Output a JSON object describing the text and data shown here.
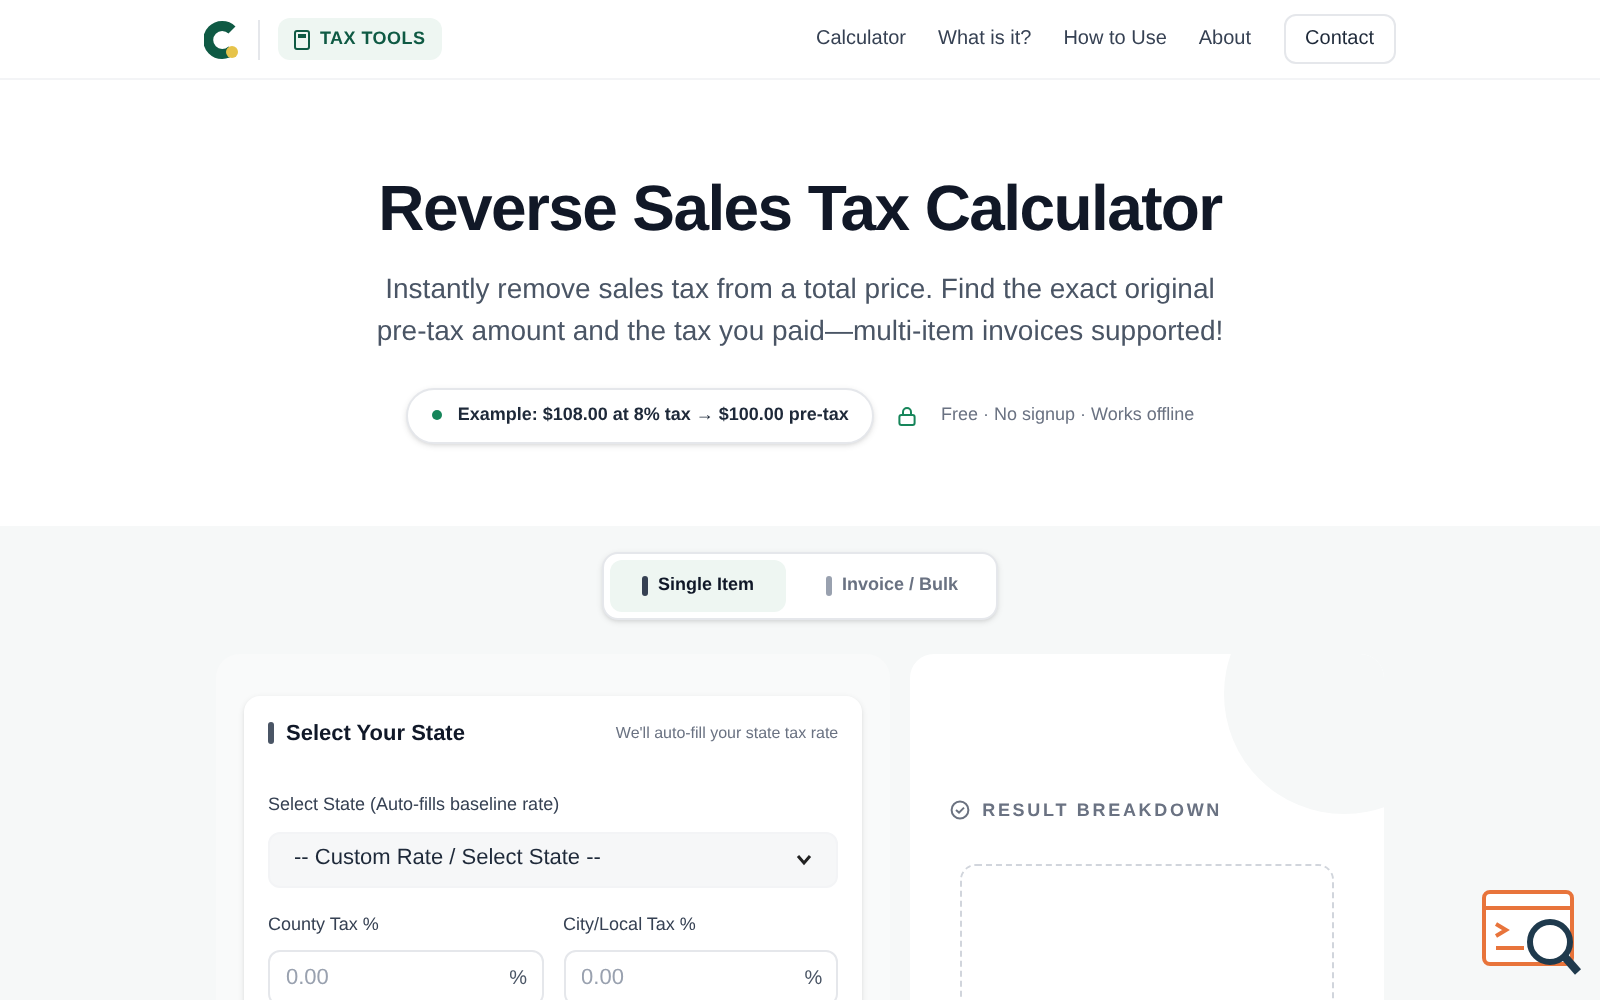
{
  "header": {
    "brand_badge": "TAX TOOLS",
    "nav": [
      {
        "label": "Calculator"
      },
      {
        "label": "What is it?"
      },
      {
        "label": "How to Use"
      },
      {
        "label": "About"
      }
    ],
    "contact_button": "Contact"
  },
  "hero": {
    "title": "Reverse Sales Tax Calculator",
    "subtitle": "Instantly remove sales tax from a total price. Find the exact original pre-tax amount and the tax you paid—multi-item invoices supported!",
    "example": "Example: $108.00 at 8% tax → $100.00 pre-tax",
    "note": "Free · No signup · Works offline"
  },
  "tabs": [
    {
      "label": "Single Item",
      "selected": true
    },
    {
      "label": "Invoice / Bulk",
      "selected": false
    }
  ],
  "state_card": {
    "title": "Select Your State",
    "hint": "We'll auto-fill your state tax rate",
    "select_label": "Select State (Auto-fills baseline rate)",
    "select_value": "-- Custom Rate / Select State --",
    "fields": [
      {
        "label": "County Tax %",
        "placeholder": "0.00",
        "suffix": "%"
      },
      {
        "label": "City/Local Tax %",
        "placeholder": "0.00",
        "suffix": "%"
      }
    ]
  },
  "result": {
    "title": "RESULT BREAKDOWN"
  }
}
